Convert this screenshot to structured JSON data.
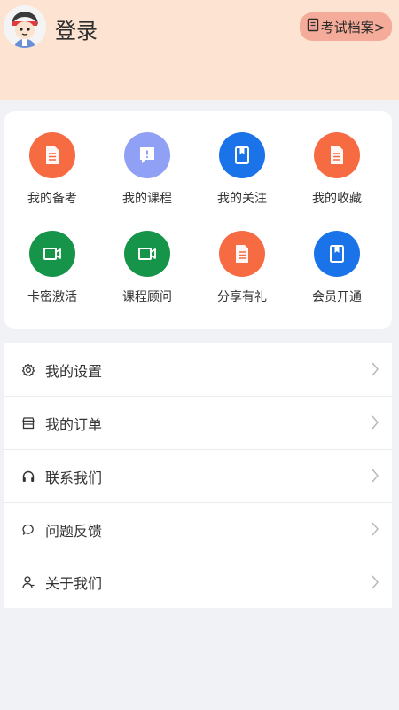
{
  "header": {
    "login_label": "登录",
    "archive_button": "考试档案>",
    "background": "#fde3d1"
  },
  "grid": {
    "items": [
      {
        "label": "我的备考",
        "icon": "document-icon",
        "color": "#f76b42"
      },
      {
        "label": "我的课程",
        "icon": "message-icon",
        "color": "#8fa0f5"
      },
      {
        "label": "我的关注",
        "icon": "bookmark-book-icon",
        "color": "#1a73e8"
      },
      {
        "label": "我的收藏",
        "icon": "document-icon",
        "color": "#f76b42"
      },
      {
        "label": "卡密激活",
        "icon": "video-icon",
        "color": "#16944a"
      },
      {
        "label": "课程顾问",
        "icon": "video-icon",
        "color": "#16944a"
      },
      {
        "label": "分享有礼",
        "icon": "document-icon",
        "color": "#f76b42"
      },
      {
        "label": "会员开通",
        "icon": "bookmark-book-icon",
        "color": "#1a73e8"
      }
    ]
  },
  "menu": {
    "items": [
      {
        "label": "我的设置",
        "icon": "gear-icon"
      },
      {
        "label": "我的订单",
        "icon": "store-icon"
      },
      {
        "label": "联系我们",
        "icon": "headphones-icon"
      },
      {
        "label": "问题反馈",
        "icon": "chat-bubble-icon"
      },
      {
        "label": "关于我们",
        "icon": "user-icon"
      }
    ]
  }
}
